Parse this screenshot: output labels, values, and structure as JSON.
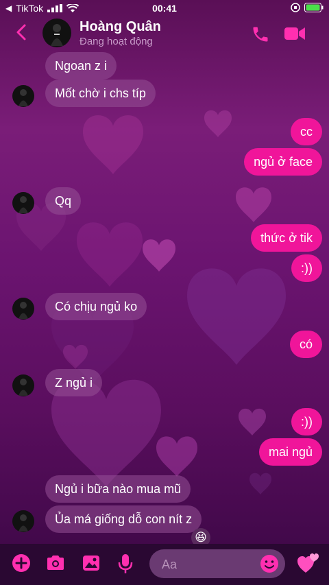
{
  "status_bar": {
    "carrier": "TikTok",
    "time": "00:41"
  },
  "header": {
    "name": "Hoàng Quân",
    "status": "Đang hoạt động"
  },
  "messages": [
    {
      "side": "in",
      "text": "Ngoan z i"
    },
    {
      "side": "in",
      "text": "Mốt chờ i chs típ"
    },
    {
      "side": "out",
      "text": "cc"
    },
    {
      "side": "out",
      "text": "ngủ ở face"
    },
    {
      "side": "in",
      "text": "Qq"
    },
    {
      "side": "out",
      "text": "thức ở tik"
    },
    {
      "side": "out",
      "text": ":))"
    },
    {
      "side": "in",
      "text": "Có chịu ngủ ko"
    },
    {
      "side": "out",
      "text": "có"
    },
    {
      "side": "in",
      "text": "Z ngủ i"
    },
    {
      "side": "out",
      "text": ":))"
    },
    {
      "side": "out",
      "text": "mai ngủ"
    },
    {
      "side": "in",
      "text": "Ngủ i bữa nào mua mũ"
    },
    {
      "side": "in",
      "text": "Ủa má giống dỗ con nít z"
    }
  ],
  "reaction": "😆",
  "composer": {
    "placeholder": "Aa"
  },
  "colors": {
    "accent": "#f0159a",
    "icon": "#ff2fb0"
  }
}
